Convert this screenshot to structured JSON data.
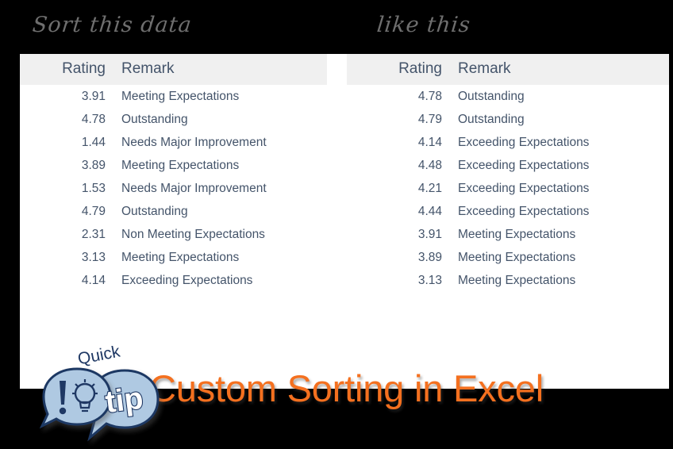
{
  "headings": {
    "left": "Sort this data",
    "right": "like this"
  },
  "colors": {
    "background": "#000000",
    "panel": "#ffffff",
    "header_band": "#f0f0f0",
    "table_text": "#44546a",
    "heading_script": "#6e6e6e",
    "title_orange": "#f4701f",
    "bubble_fill": "#afc9e2",
    "bubble_outline": "#1f3864",
    "bulb_yellow": "#f2c94c"
  },
  "tables": {
    "left": {
      "name": "unsorted-data-table",
      "columns": [
        "Rating",
        "Remark"
      ],
      "rows": [
        {
          "rating": "3.91",
          "remark": "Meeting Expectations"
        },
        {
          "rating": "4.78",
          "remark": "Outstanding"
        },
        {
          "rating": "1.44",
          "remark": "Needs Major Improvement"
        },
        {
          "rating": "3.89",
          "remark": "Meeting Expectations"
        },
        {
          "rating": "1.53",
          "remark": "Needs Major Improvement"
        },
        {
          "rating": "4.79",
          "remark": "Outstanding"
        },
        {
          "rating": "2.31",
          "remark": "Non Meeting Expectations"
        },
        {
          "rating": "3.13",
          "remark": "Meeting Expectations"
        },
        {
          "rating": "4.14",
          "remark": "Exceeding Expectations"
        }
      ]
    },
    "right": {
      "name": "sorted-data-table",
      "columns": [
        "Rating",
        "Remark"
      ],
      "rows": [
        {
          "rating": "4.78",
          "remark": "Outstanding"
        },
        {
          "rating": "4.79",
          "remark": "Outstanding"
        },
        {
          "rating": "4.14",
          "remark": "Exceeding Expectations"
        },
        {
          "rating": "4.48",
          "remark": "Exceeding Expectations"
        },
        {
          "rating": "4.21",
          "remark": "Exceeding Expectations"
        },
        {
          "rating": "4.44",
          "remark": "Exceeding Expectations"
        },
        {
          "rating": "3.91",
          "remark": "Meeting Expectations"
        },
        {
          "rating": "3.89",
          "remark": "Meeting Expectations"
        },
        {
          "rating": "3.13",
          "remark": "Meeting Expectations"
        }
      ]
    }
  },
  "title": {
    "text": "Custom Sorting in Excel"
  },
  "badge": {
    "word_quick": "Quick",
    "word_tip": "tip",
    "icons": [
      "exclamation-mark-icon",
      "lightbulb-icon"
    ]
  }
}
